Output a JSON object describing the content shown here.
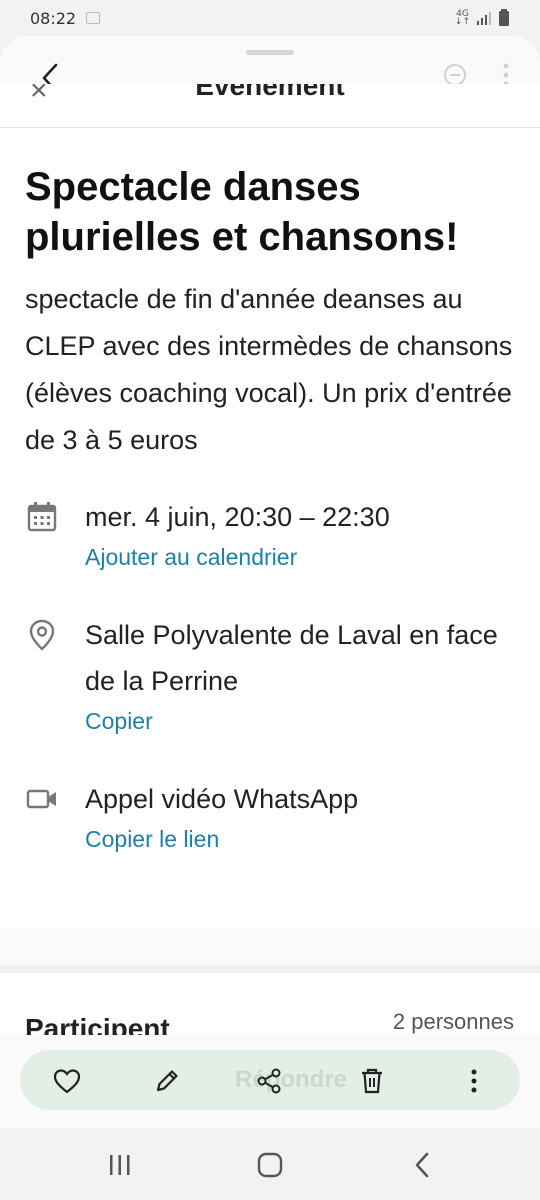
{
  "status": {
    "time": "08:22",
    "network": "4G"
  },
  "behind": {
    "header_title": "Événement",
    "close_symbol": "×"
  },
  "event": {
    "title": "Spectacle danses plurielles et chansons!",
    "description": "spectacle de fin d'année deanses au CLEP avec des intermèdes de chansons (élèves coaching vocal). Un prix d'entrée de 3 à 5 euros",
    "date": {
      "icon": "calendar-icon",
      "text": "mer. 4 juin, 20:30 – 22:30",
      "link": "Ajouter au calendrier"
    },
    "location": {
      "icon": "location-pin-icon",
      "text": "Salle Polyvalente de Laval en face de la Perrine",
      "link": "Copier"
    },
    "video": {
      "icon": "video-camera-icon",
      "text": "Appel vidéo WhatsApp",
      "link": "Copier le lien"
    }
  },
  "participants": {
    "label": "Participent",
    "count": "2 personnes"
  },
  "actions": {
    "ghost_label": "Répondre"
  },
  "colors": {
    "link": "#1f7fa5",
    "action_bar": "#e3eee7"
  }
}
